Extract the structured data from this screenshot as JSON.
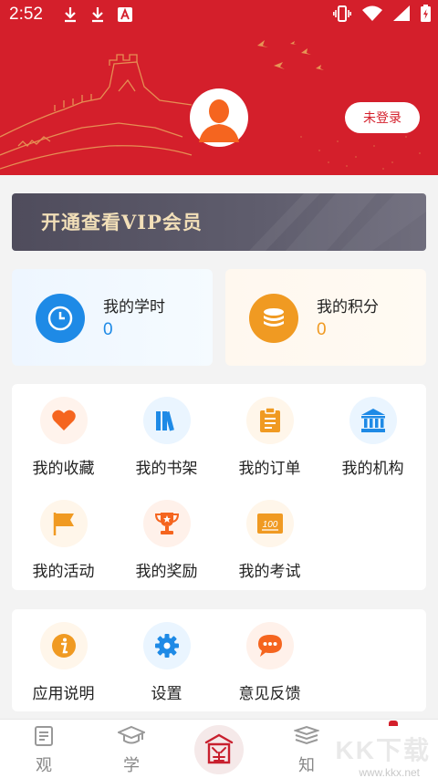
{
  "status_bar": {
    "time": "2:52"
  },
  "header": {
    "login_button": "未登录"
  },
  "vip_banner": {
    "text": "开通查看VIP会员"
  },
  "stats": {
    "hours": {
      "title": "我的学时",
      "value": "0",
      "color": "#1e8ae6"
    },
    "points": {
      "title": "我的积分",
      "value": "0",
      "color": "#f09a22"
    }
  },
  "grid": {
    "favorites": "我的收藏",
    "bookshelf": "我的书架",
    "orders": "我的订单",
    "institution": "我的机构",
    "activities": "我的活动",
    "rewards": "我的奖励",
    "exams": "我的考试"
  },
  "settings": {
    "app_info": "应用说明",
    "settings": "设置",
    "feedback": "意见反馈"
  },
  "bottom_nav": {
    "view": "观",
    "learn": "学",
    "know": "知"
  },
  "watermark": {
    "brand": "KK下载",
    "url": "www.kkx.net"
  },
  "colors": {
    "brand_red": "#d41f2b",
    "orange": "#f5651f",
    "blue": "#1e8ae6"
  }
}
